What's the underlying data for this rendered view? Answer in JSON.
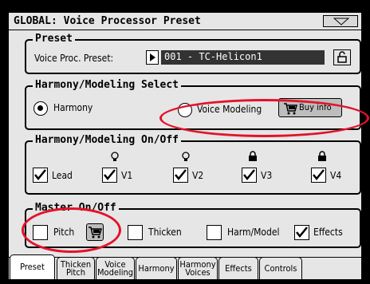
{
  "title": "GLOBAL: Voice Processor Preset",
  "preset": {
    "group_title": "Preset",
    "label": "Voice Proc. Preset:",
    "value": "001 - TC-Helicon1"
  },
  "select": {
    "group_title": "Harmony/Modeling Select",
    "option_harmony": "Harmony",
    "option_modeling": "Voice Modeling",
    "buy_info": "Buy info",
    "selected": "Harmony"
  },
  "onoff": {
    "group_title": "Harmony/Modeling On/Off",
    "items": [
      {
        "label": "Lead",
        "checked": true,
        "icon": "none"
      },
      {
        "label": "V1",
        "checked": true,
        "icon": "bulb-icon"
      },
      {
        "label": "V2",
        "checked": true,
        "icon": "bulb-icon"
      },
      {
        "label": "V3",
        "checked": true,
        "icon": "lock-icon"
      },
      {
        "label": "V4",
        "checked": true,
        "icon": "lock-icon"
      }
    ]
  },
  "master": {
    "group_title": "Master On/Off",
    "items": [
      {
        "label": "Pitch",
        "checked": false
      },
      {
        "label": "Thicken",
        "checked": false
      },
      {
        "label": "Harm/Model",
        "checked": false
      },
      {
        "label": "Effects",
        "checked": true
      }
    ]
  },
  "tabs": [
    {
      "label": "Preset",
      "active": true
    },
    {
      "label": "Thicken\nPitch",
      "active": false
    },
    {
      "label": "Voice\nModeling",
      "active": false
    },
    {
      "label": "Harmony",
      "active": false
    },
    {
      "label": "Harmony\nVoices",
      "active": false
    },
    {
      "label": "Effects",
      "active": false
    },
    {
      "label": "Controls",
      "active": false
    }
  ],
  "colors": {
    "highlight": "#e2132a",
    "screen_bg": "#e6e6e6"
  }
}
